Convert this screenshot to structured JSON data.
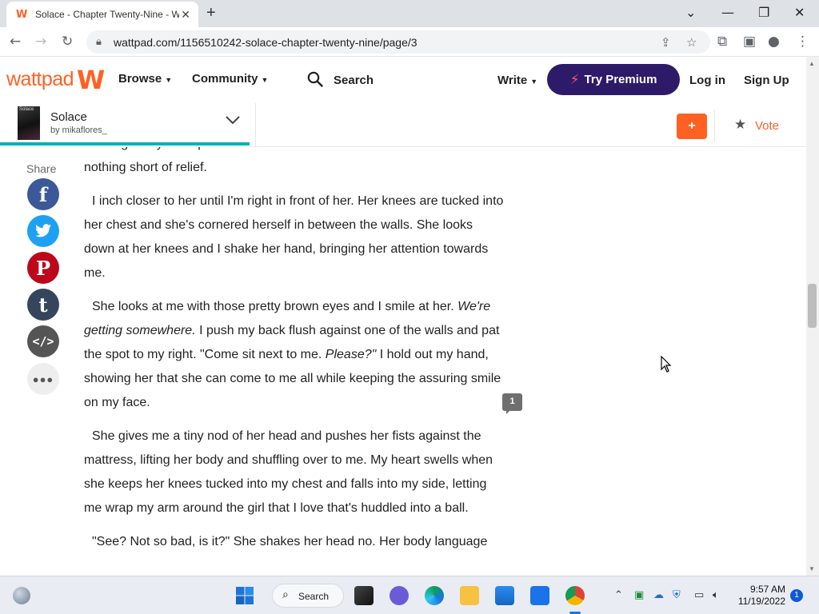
{
  "browser": {
    "tab_title": "Solace - Chapter Twenty-Nine - Wattpad",
    "tab_close": "✕",
    "new_tab": "+",
    "url": "wattpad.com/1156510242-solace-chapter-twenty-nine/page/3"
  },
  "header": {
    "logo_text": "wattpad",
    "logo_mark": "W",
    "browse_label": "Browse",
    "community_label": "Community",
    "search_label": "Search",
    "write_label": "Write",
    "premium_label": "Try Premium",
    "login_label": "Log in",
    "signup_label": "Sign Up"
  },
  "story": {
    "cover_text": "Solace",
    "title": "Solace",
    "author": "by mikaflores_",
    "add_label": "+",
    "vote_label": "Vote",
    "progress_percent": 31
  },
  "share": {
    "label": "Share",
    "items": [
      {
        "name": "facebook",
        "glyph": "f",
        "color": "#3b5998"
      },
      {
        "name": "twitter",
        "glyph": "t",
        "color": "#1da1f2"
      },
      {
        "name": "pinterest",
        "glyph": "P",
        "color": "#bd081c"
      },
      {
        "name": "tumblr",
        "glyph": "t",
        "color": "#35465c"
      },
      {
        "name": "embed",
        "glyph": "</>",
        "color": "#555555"
      },
      {
        "name": "more",
        "glyph": "•••",
        "color": "#eeeeee"
      }
    ]
  },
  "content": {
    "p0": "thinking I may have pushed it a bit far. But when she nods her head I feel nothing short of relief.",
    "p1": "I inch closer to her until I'm right in front of her. Her knees are tucked into her chest and she's cornered herself in between the walls. She looks down at her knees and I shake her hand, bringing her attention towards me.",
    "p2a": "She looks at me with those pretty brown eyes and I smile at her. ",
    "p2b": "We're getting somewhere.",
    "p2c": " I push my back flush against one of the walls and pat the spot to my right. \"Come sit next to me. ",
    "p2d": "Please?\"",
    "p2e": " I hold out my hand, showing her that she can come to me all while keeping the assuring smile on my face.",
    "p3": "She gives me a tiny nod of her head and pushes her fists against the mattress, lifting her body and shuffling over to me. My heart swells when she keeps her knees tucked into my chest and falls into my side, letting me wrap my arm around the girl that I love that's huddled into a ball.",
    "p4": "\"See? Not so bad, is it?\" She shakes her head no. Her body language",
    "comment_count": "1"
  },
  "taskbar": {
    "search_label": "Search",
    "time": "9:57 AM",
    "date": "11/19/2022",
    "notification_count": "1"
  }
}
